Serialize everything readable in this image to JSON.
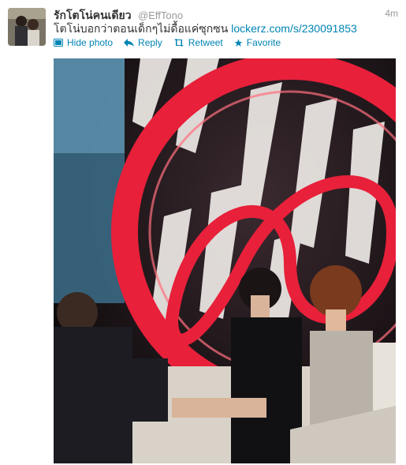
{
  "tweet": {
    "fullname": "รักโตโน่คนเดียว",
    "screen_name": "@EffTono",
    "time": "4m",
    "text": "โตโน่บอกว่าตอนเด็กๆไม่ดื้อแค่ซุกซน",
    "link": "lockerz.com/s/230091853"
  },
  "actions": {
    "hide_photo": "Hide photo",
    "reply": "Reply",
    "retweet": "Retweet",
    "favorite": "Favorite"
  },
  "colors": {
    "link": "#0084b4",
    "muted": "#999999",
    "stage_red": "#e8203a"
  }
}
